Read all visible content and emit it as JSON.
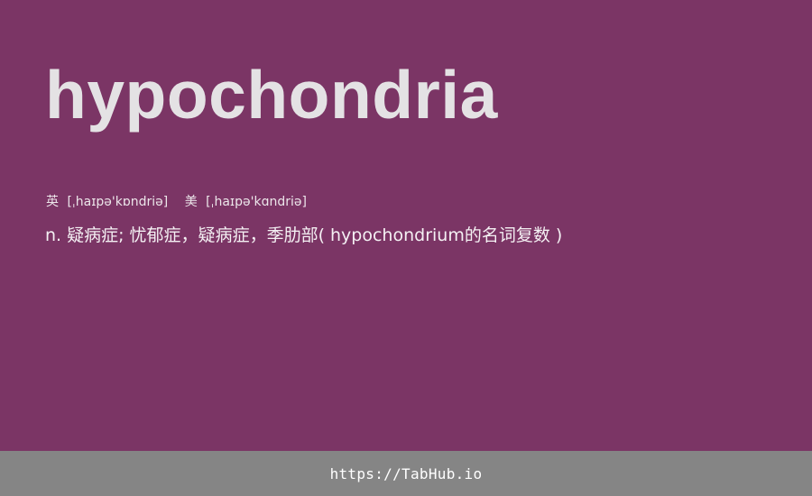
{
  "word": "hypochondria",
  "pronunciations": [
    {
      "label": "英",
      "ipa": "[ˌhaɪpə'kɒndriə]"
    },
    {
      "label": "美",
      "ipa": "[ˌhaɪpə'kɑndriə]"
    }
  ],
  "definition": "n. 疑病症; 忧郁症，疑病症，季肋部( hypochondrium的名词复数 )",
  "footer": {
    "link_text": "https://TabHub.io"
  },
  "colors": {
    "background": "#7b3565",
    "headword": "#e4e2e4",
    "footer_bar": "#858585"
  }
}
